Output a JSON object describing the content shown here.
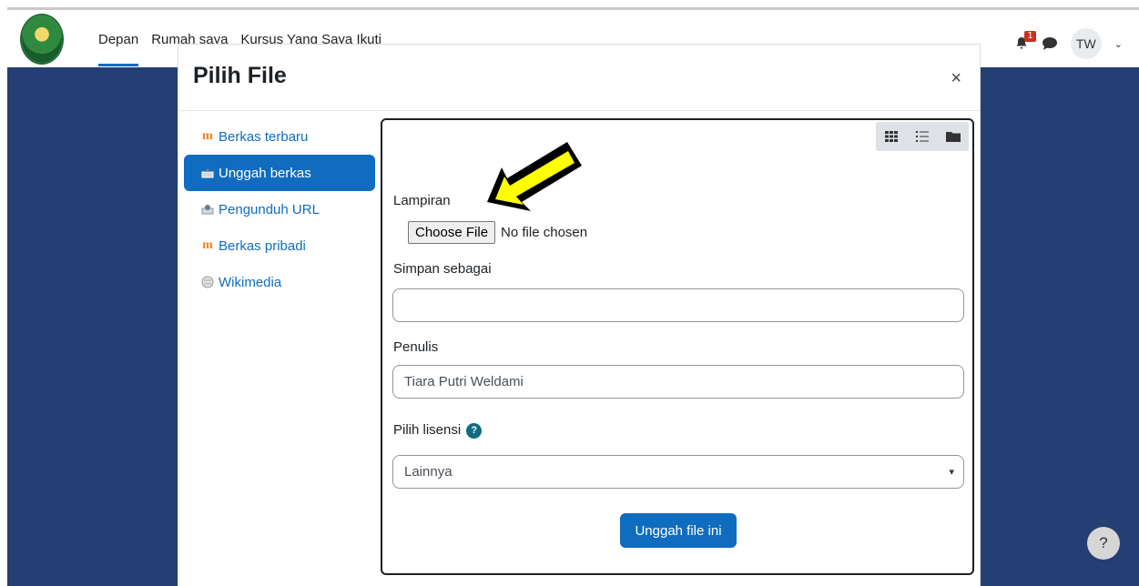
{
  "nav": {
    "links": [
      "Depan",
      "Rumah saya",
      "Kursus Yang Saya Ikuti"
    ]
  },
  "topbar": {
    "notification_count": "1",
    "avatar_initials": "TW"
  },
  "modal": {
    "title": "Pilih File",
    "close_label": "×",
    "sidebar": [
      {
        "label": "Berkas terbaru",
        "icon": "moodle-icon"
      },
      {
        "label": "Unggah berkas",
        "icon": "upload-icon"
      },
      {
        "label": "Pengunduh URL",
        "icon": "url-downloader-icon"
      },
      {
        "label": "Berkas pribadi",
        "icon": "moodle-icon"
      },
      {
        "label": "Wikimedia",
        "icon": "wikimedia-icon"
      }
    ],
    "form": {
      "attachment_label": "Lampiran",
      "choose_file_label": "Choose File",
      "no_file_text": "No file chosen",
      "save_as_label": "Simpan sebagai",
      "save_as_value": "",
      "author_label": "Penulis",
      "author_value": "Tiara Putri Weldami",
      "license_label": "Pilih lisensi",
      "license_value": "Lainnya",
      "submit_label": "Unggah file ini"
    }
  },
  "help_fab": "?",
  "colors": {
    "brand": "#0f6cbf",
    "backdrop": "#233f73",
    "arrow": "#ffff00"
  }
}
